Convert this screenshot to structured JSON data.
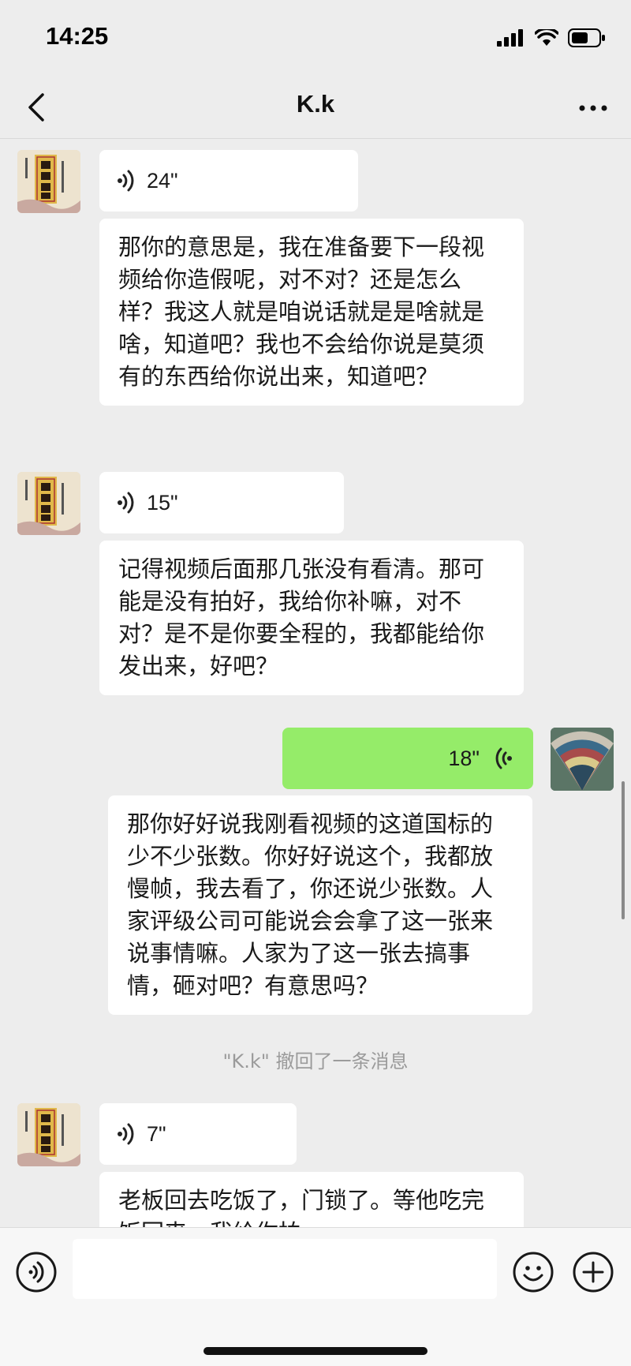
{
  "status_bar": {
    "time": "14:25"
  },
  "nav": {
    "title": "K.k"
  },
  "messages": {
    "m1": {
      "voice_duration": "24\""
    },
    "m2": {
      "text": "那你的意思是，我在准备要下一段视频给你造假呢，对不对？还是怎么样？我这人就是咱说话就是是啥就是啥，知道吧？我也不会给你说是莫须有的东西给你说出来，知道吧？"
    },
    "m3": {
      "voice_duration": "15\""
    },
    "m4": {
      "text": "记得视频后面那几张没有看清。那可能是没有拍好，我给你补嘛，对不对？是不是你要全程的，我都能给你发出来，好吧？"
    },
    "m5": {
      "voice_duration": "18\""
    },
    "m6": {
      "text": "那你好好说我刚看视频的这道国标的少不少张数。你好好说这个，我都放慢帧，我去看了，你还说少张数。人家评级公司可能说会会拿了这一张来说事情嘛。人家为了这一张去搞事情，砸对吧？有意思吗？"
    },
    "system": "\"K.k\" 撤回了一条消息",
    "m7": {
      "voice_duration": "7\""
    },
    "m8": {
      "text": "老板回去吃饭了，门锁了。等他吃完饭回来，我给你拍。"
    }
  },
  "colors": {
    "self_bubble": "#95ec69",
    "other_bubble": "#ffffff",
    "background": "#ededed"
  }
}
